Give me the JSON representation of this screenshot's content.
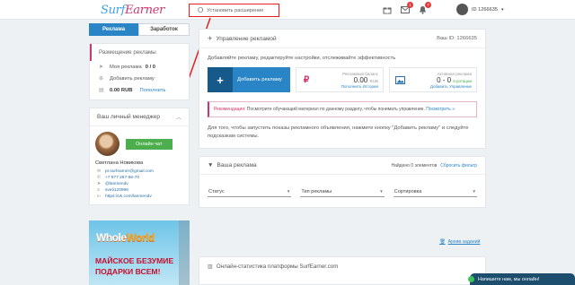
{
  "topbar": {
    "logo_part1": "Surf",
    "logo_part2": "Earner",
    "extension_label": "Установить расширение",
    "notifications": [
      {
        "icon": "gift-icon",
        "badge": ""
      },
      {
        "icon": "envelope-icon",
        "badge": "1"
      },
      {
        "icon": "bell-icon",
        "badge": "7"
      }
    ],
    "user_id": "ID 1266635"
  },
  "tabs": [
    {
      "label": "Реклама",
      "active": true
    },
    {
      "label": "Заработок",
      "active": false
    }
  ],
  "sidebar": {
    "section_title": "Размещение рекламы",
    "my_ads_label": "Моя реклама",
    "my_ads_count": "0 / 0",
    "add_ad_label": "Добавить рекламу",
    "balance": "0.00 RUB",
    "topup_label": "Пополнить"
  },
  "manager": {
    "title": "Ваш личный менеджер",
    "chat_label": "Онлайн чат",
    "name": "Светлана Новикова",
    "contacts": [
      {
        "icon": "email-icon",
        "text": "pr.surfearner@gmail.com"
      },
      {
        "icon": "phone-icon",
        "text": "+7 977 267-66-70"
      },
      {
        "icon": "telegram-icon",
        "text": "@lanmendv"
      },
      {
        "icon": "skype-icon",
        "text": "sveti120996"
      },
      {
        "icon": "vk-icon",
        "text": "https://vk.com/lanmendv"
      }
    ]
  },
  "banner": {
    "logo_a": "Whole",
    "logo_b": "World",
    "line1": "МАЙСКОЕ БЕЗУМИЕ",
    "line2": "ПОДАРКИ ВСЕМ!"
  },
  "main": {
    "title": "Управление рекламой",
    "account_id": "Ваш ID: 1266635",
    "subtitle": "Добавляйте рекламу, редактируйте настройки, отслеживайте эффективность",
    "add_button": "Добавить рекламу",
    "balance_label": "Рекламный баланс",
    "balance_value": "0.00",
    "balance_unit": "RUB",
    "balance_links": "Пополнить   История",
    "active_label": "Активная реклама",
    "active_value": "0 - 0",
    "active_rotation": "в ротации",
    "active_links": "Добавить   Управление",
    "recommend_label": "Рекомендация:",
    "recommend_text": " Посмотрите обучающий материал по данному разделу, чтобы понимать управление.",
    "recommend_link": "Посмотреть »",
    "description": "Для того, чтобы запустить показы рекламного объявления, нажмите кнопку \"Добавить рекламу\" и следуйте подсказкам системы."
  },
  "ads": {
    "title": "Ваша реклама",
    "found": "Найдено 0 элементов",
    "reset_filter": "Сбросить фильтр",
    "filters": [
      "Статус",
      "Тип рекламы",
      "Сортировка"
    ]
  },
  "archive_label": "Архив заданий",
  "stats_title": "Онлайн-статистика платформы SurfEarner.com",
  "chat_widget": "Напишите нам, мы онлайн!",
  "colors": {
    "primary": "#2a85c6",
    "accent": "#d2336b",
    "success": "#4cae4c",
    "highlight": "#e22020"
  }
}
